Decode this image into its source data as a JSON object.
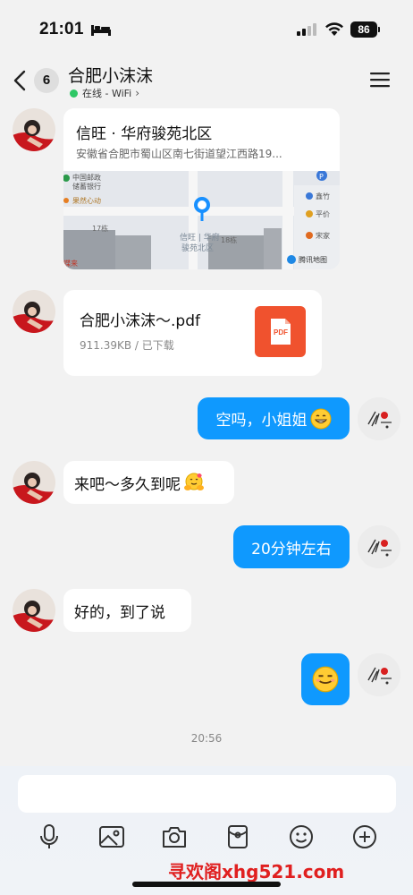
{
  "status_bar": {
    "time": "21:01",
    "battery": "86",
    "icons": [
      "bed-icon",
      "signal-icon",
      "wifi-icon",
      "battery-icon"
    ]
  },
  "nav": {
    "unread_count": "6",
    "contact_name": "合肥小沫沫",
    "status": "在线 - WiFi",
    "status_color": "#2ec765",
    "icons": [
      "back-icon",
      "chevron-right-icon",
      "menu-icon"
    ]
  },
  "messages": {
    "location": {
      "title": "信旺 · 华府骏苑北区",
      "address": "安徽省合肥市蜀山区南七街道望江西路19...",
      "map_labels": [
        "中国邮政",
        "储蓄银行",
        "果然心动",
        "17栋",
        "信旺 | 华府",
        "骏苑北区",
        "18栋",
        "鑫竹",
        "平价",
        "宋家",
        "蝶来",
        "腾讯地图"
      ]
    },
    "file": {
      "name": "合肥小沫沫～.pdf",
      "meta": "911.39KB / 已下载",
      "icon_label": "PDF"
    },
    "msg1": "空吗，小姐姐",
    "msg2": "来吧～多久到呢",
    "msg3": "20分钟左右",
    "msg4": "好的，到了说",
    "timestamp": "20:56"
  },
  "input": {
    "placeholder": "",
    "toolbar_icons": [
      "microphone-icon",
      "image-icon",
      "camera-icon",
      "red-packet-icon",
      "emoji-icon",
      "plus-icon"
    ]
  },
  "watermark": "寻欢阁xhg521.com",
  "colors": {
    "accent_blue": "#0f99fe",
    "background": "#f2f2f2",
    "pdf_red": "#f0522e",
    "watermark_red": "#e02020"
  }
}
